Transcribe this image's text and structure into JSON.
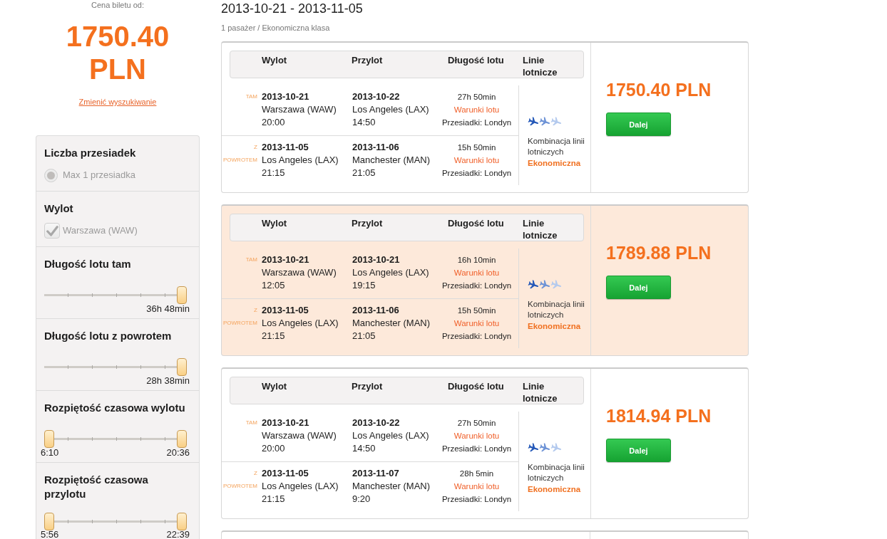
{
  "sidebar": {
    "price_caption": "Cena biletu od:",
    "price": "1750.40 PLN",
    "change_search_link": "Zmienić wyszukiwanie",
    "filters": [
      {
        "kind": "radio",
        "title": "Liczba przesiadek",
        "option": {
          "label": "Max 1 przesiadka",
          "checked": true,
          "disabled": true
        }
      },
      {
        "kind": "checkbox",
        "title": "Wylot",
        "option": {
          "label": "Warszawa (WAW)",
          "checked": true,
          "disabled": true
        }
      },
      {
        "kind": "slider",
        "title": "Długość lotu tam",
        "level": 1,
        "reading": "36h 48min"
      },
      {
        "kind": "slider",
        "title": "Długość lotu z powrotem",
        "level": 1,
        "reading": "28h 38min"
      },
      {
        "kind": "range",
        "title": "Rozpiętość czasowa wylotu",
        "handles": [
          {
            "level": 0,
            "reading": "6:10"
          },
          {
            "level": 1,
            "reading": "20:36"
          }
        ]
      },
      {
        "kind": "range",
        "title": "Rozpiętość czasowa przylotu",
        "handles": [
          {
            "level": 0,
            "reading": "5:56"
          },
          {
            "level": 1,
            "reading": "22:39"
          }
        ]
      }
    ]
  },
  "results": {
    "dates": "2013-10-21 - 2013-11-05",
    "passengers": "1 pasażer / Ekonomiczna klasa",
    "offers": [
      {
        "highlighted": false,
        "columns": [
          "Wylot",
          "Przylot",
          "Długość lotu",
          "Linie lotnicze"
        ],
        "legs": [
          {
            "label": "TAM",
            "departure": {
              "date": "2013-10-21",
              "place": "Warszawa (WAW)",
              "time": "20:00"
            },
            "arrival": {
              "date": "2013-10-22",
              "place": "Los Angeles (LAX)",
              "time": "14:50"
            },
            "duration": "27h 50min",
            "conditions_link": "Warunki lotu",
            "stopovers": "Przesiadki: Londyn"
          },
          {
            "label": "Z POWROTEM",
            "departure": {
              "date": "2013-11-05",
              "place": "Los Angeles (LAX)",
              "time": "21:15"
            },
            "arrival": {
              "date": "2013-11-06",
              "place": "Manchester (MAN)",
              "time": "21:05"
            },
            "duration": "15h 50min",
            "conditions_link": "Warunki lotu",
            "stopovers": "Przesiadki: Londyn"
          }
        ],
        "airline": "Kombinacja linii lotniczych",
        "fare_class": "Ekonomiczna",
        "price": "1750.40 PLN",
        "button": "Dalej"
      },
      {
        "highlighted": true,
        "columns": [
          "Wylot",
          "Przylot",
          "Długość lotu",
          "Linie lotnicze"
        ],
        "legs": [
          {
            "label": "TAM",
            "departure": {
              "date": "2013-10-21",
              "place": "Warszawa (WAW)",
              "time": "12:05"
            },
            "arrival": {
              "date": "2013-10-21",
              "place": "Los Angeles (LAX)",
              "time": "19:15"
            },
            "duration": "16h 10min",
            "conditions_link": "Warunki lotu",
            "stopovers": "Przesiadki: Londyn"
          },
          {
            "label": "Z POWROTEM",
            "departure": {
              "date": "2013-11-05",
              "place": "Los Angeles (LAX)",
              "time": "21:15"
            },
            "arrival": {
              "date": "2013-11-06",
              "place": "Manchester (MAN)",
              "time": "21:05"
            },
            "duration": "15h 50min",
            "conditions_link": "Warunki lotu",
            "stopovers": "Przesiadki: Londyn"
          }
        ],
        "airline": "Kombinacja linii lotniczych",
        "fare_class": "Ekonomiczna",
        "price": "1789.88 PLN",
        "button": "Dalej"
      },
      {
        "highlighted": false,
        "columns": [
          "Wylot",
          "Przylot",
          "Długość lotu",
          "Linie lotnicze"
        ],
        "legs": [
          {
            "label": "TAM",
            "departure": {
              "date": "2013-10-21",
              "place": "Warszawa (WAW)",
              "time": "20:00"
            },
            "arrival": {
              "date": "2013-10-22",
              "place": "Los Angeles (LAX)",
              "time": "14:50"
            },
            "duration": "27h 50min",
            "conditions_link": "Warunki lotu",
            "stopovers": "Przesiadki: Londyn"
          },
          {
            "label": "Z POWROTEM",
            "departure": {
              "date": "2013-11-05",
              "place": "Los Angeles (LAX)",
              "time": "21:15"
            },
            "arrival": {
              "date": "2013-11-07",
              "place": "Manchester (MAN)",
              "time": "9:20"
            },
            "duration": "28h 5min",
            "conditions_link": "Warunki lotu",
            "stopovers": "Przesiadki: Londyn"
          }
        ],
        "airline": "Kombinacja linii lotniczych",
        "fare_class": "Ekonomiczna",
        "price": "1814.94 PLN",
        "button": "Dalej"
      }
    ]
  }
}
